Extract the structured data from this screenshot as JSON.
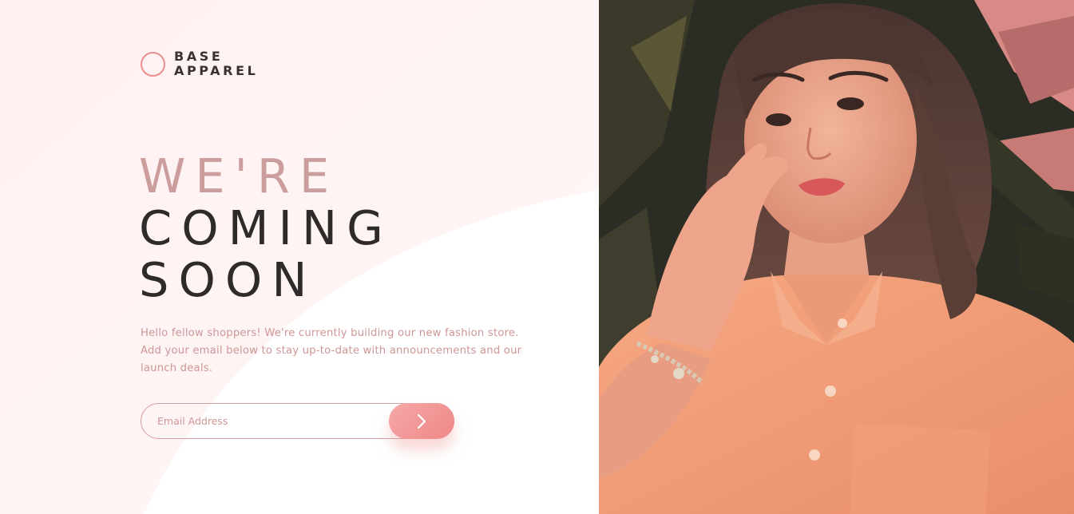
{
  "brand": {
    "line1": "BASE",
    "line2": "APPAREL"
  },
  "headline": {
    "line1": "We're",
    "line2": "coming",
    "line3": "soon"
  },
  "intro": "Hello fellow shoppers! We're currently building our new fashion store. Add your email below to stay up-to-date with announcements and our launch deals.",
  "signup": {
    "placeholder": "Email Address",
    "submit_icon": "chevron-right-icon"
  },
  "colors": {
    "accent": "#ee8e8e",
    "headline_light": "#cc9d9d",
    "headline_dark": "#2f2b2b",
    "text": "#ce9797",
    "background": "#fff5f5"
  },
  "hero": {
    "icon": "hero-portrait-image"
  }
}
